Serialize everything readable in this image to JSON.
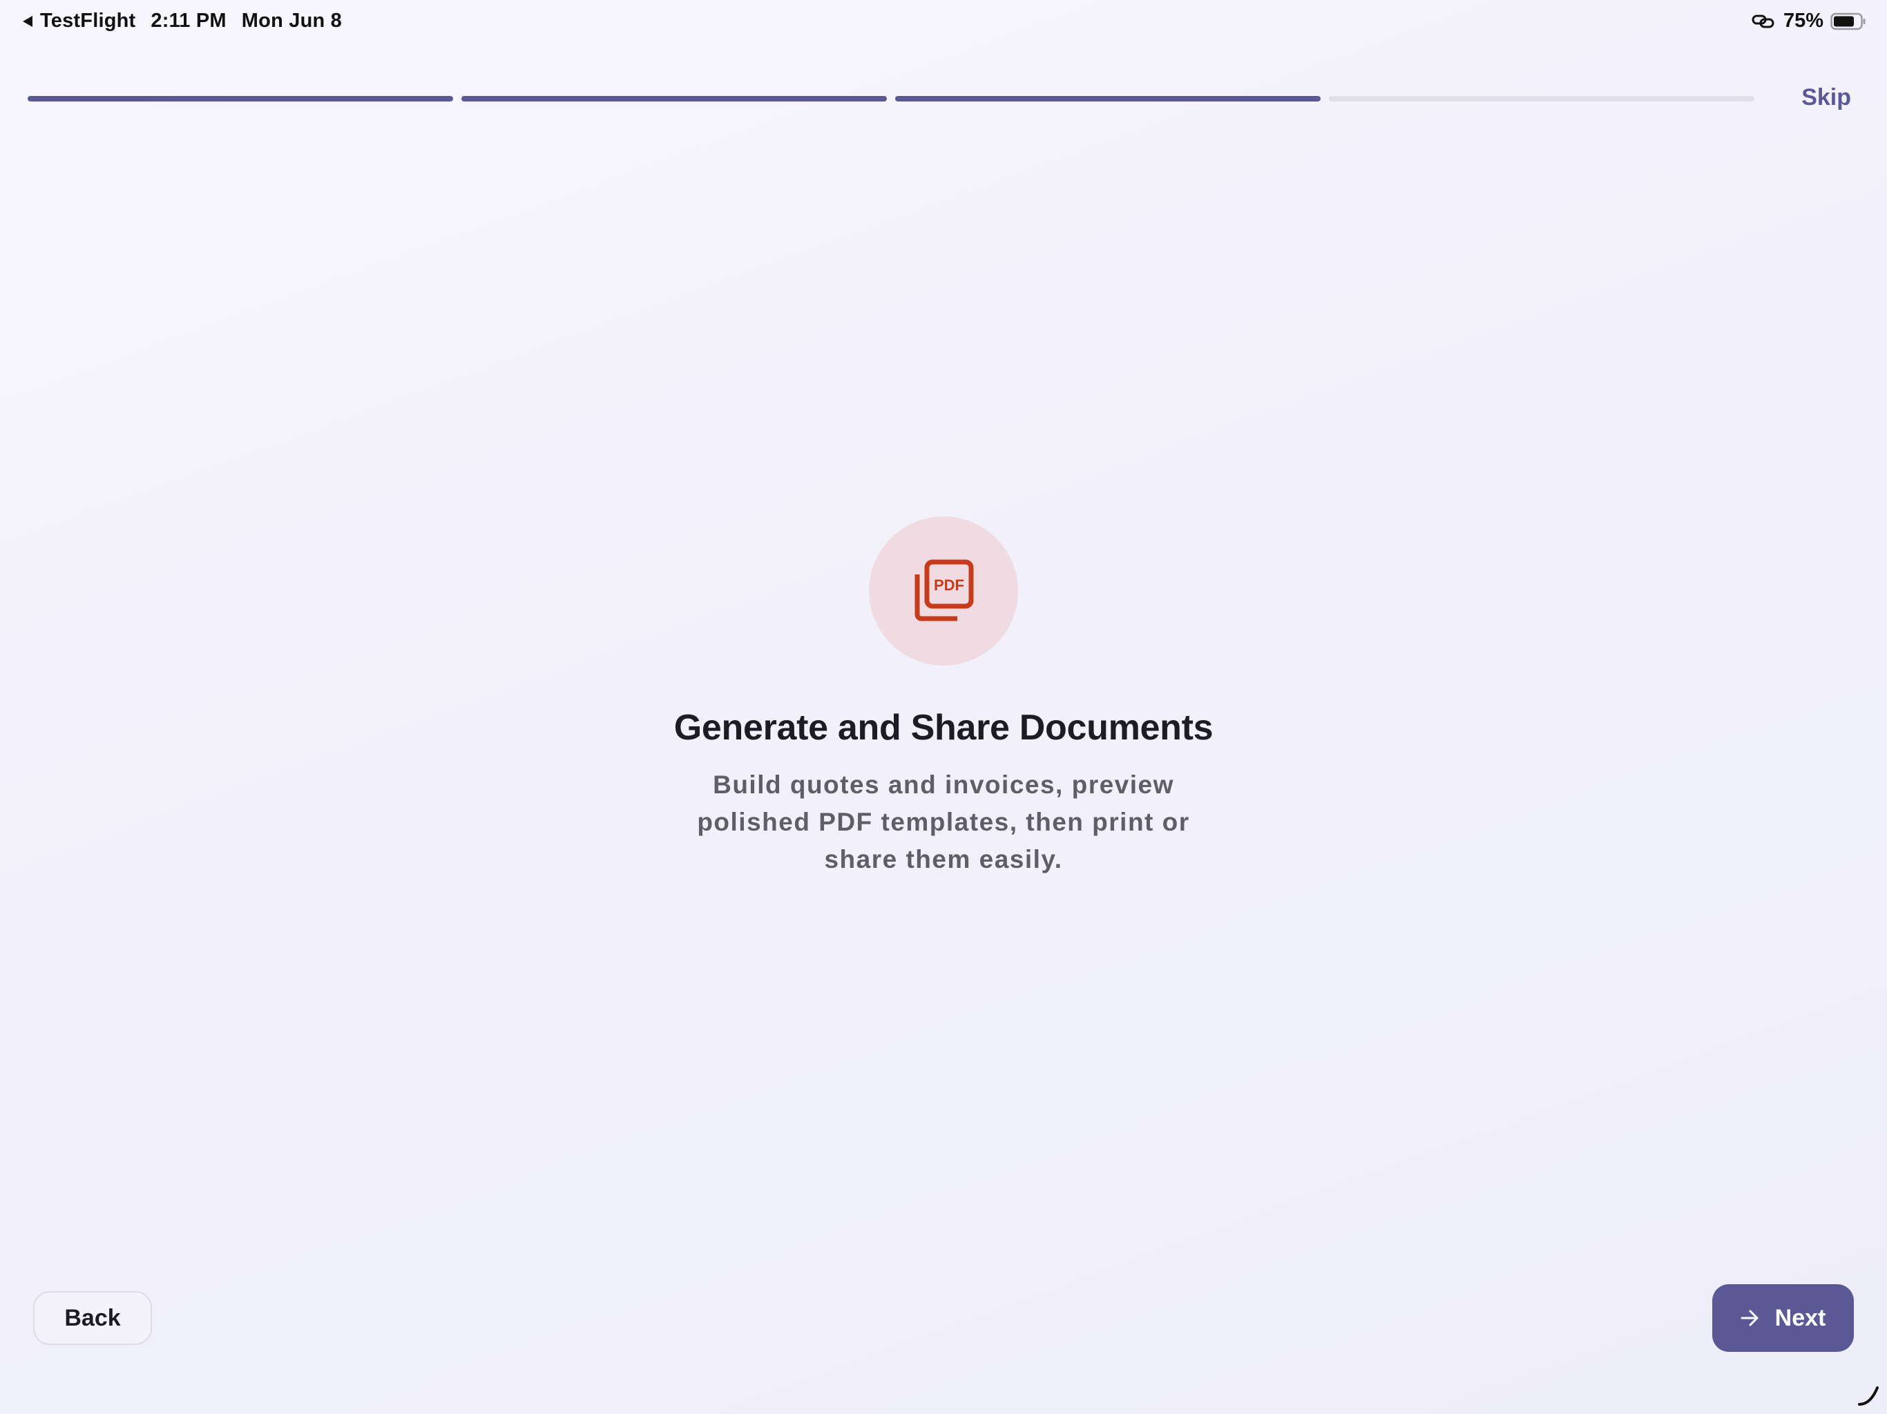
{
  "status_bar": {
    "back_app": "TestFlight",
    "time": "2:11 PM",
    "date": "Mon Jun 8",
    "battery_percent": "75%",
    "icons": [
      "back-triangle-icon",
      "link-icon",
      "battery-icon"
    ]
  },
  "onboarding": {
    "progress": {
      "total_steps": 4,
      "completed_steps": 3
    },
    "skip_label": "Skip",
    "icon": "pdf-document-icon",
    "title": "Generate and Share Documents",
    "description": "Build quotes and invoices, preview polished PDF templates, then print or share them easily."
  },
  "navigation": {
    "back_label": "Back",
    "next_label": "Next",
    "next_icon": "arrow-right-icon"
  },
  "colors": {
    "accent": "#5b5995",
    "progress_inactive": "#e0dfe8",
    "icon_red": "#c43c1c",
    "icon_circle_bg": "#f0dbe2",
    "title_text": "#1c1c22",
    "description_text": "#5f5e66"
  }
}
